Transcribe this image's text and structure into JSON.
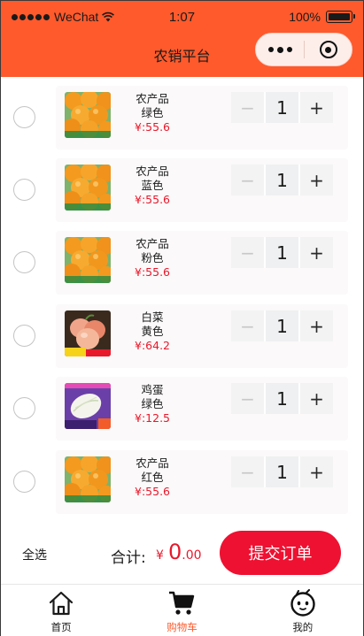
{
  "status_bar": {
    "carrier": "WeChat",
    "time": "1:07",
    "battery": "100%"
  },
  "nav": {
    "title": "农销平台",
    "more_icon": "more-dots-icon",
    "close_icon": "target-close-icon"
  },
  "cart": {
    "items": [
      {
        "name": "农产品",
        "variant": "绿色",
        "price": "¥:55.6",
        "quantity": "1",
        "image": "oranges"
      },
      {
        "name": "农产品",
        "variant": "蓝色",
        "price": "¥:55.6",
        "quantity": "1",
        "image": "oranges"
      },
      {
        "name": "农产品",
        "variant": "粉色",
        "price": "¥:55.6",
        "quantity": "1",
        "image": "oranges"
      },
      {
        "name": "白菜",
        "variant": "黄色",
        "price": "¥:64.2",
        "quantity": "1",
        "image": "peaches"
      },
      {
        "name": "鸡蛋",
        "variant": "绿色",
        "price": "¥:12.5",
        "quantity": "1",
        "image": "cabbage"
      },
      {
        "name": "农产品",
        "variant": "红色",
        "price": "¥:55.6",
        "quantity": "1",
        "image": "oranges"
      }
    ],
    "minus_label": "−",
    "plus_label": "+"
  },
  "summary": {
    "select_all": "全选",
    "total_label": "合计:",
    "currency": "¥",
    "total_int": "0",
    "total_dec": ".00",
    "submit_label": "提交订单"
  },
  "tabbar": {
    "tabs": [
      {
        "label": "首页",
        "icon": "home-icon"
      },
      {
        "label": "购物车",
        "icon": "cart-icon",
        "active": true
      },
      {
        "label": "我的",
        "icon": "profile-face-icon"
      }
    ]
  },
  "colors": {
    "brand": "#ff5a2c",
    "price": "#e8182b",
    "submit": "#ee1131"
  }
}
